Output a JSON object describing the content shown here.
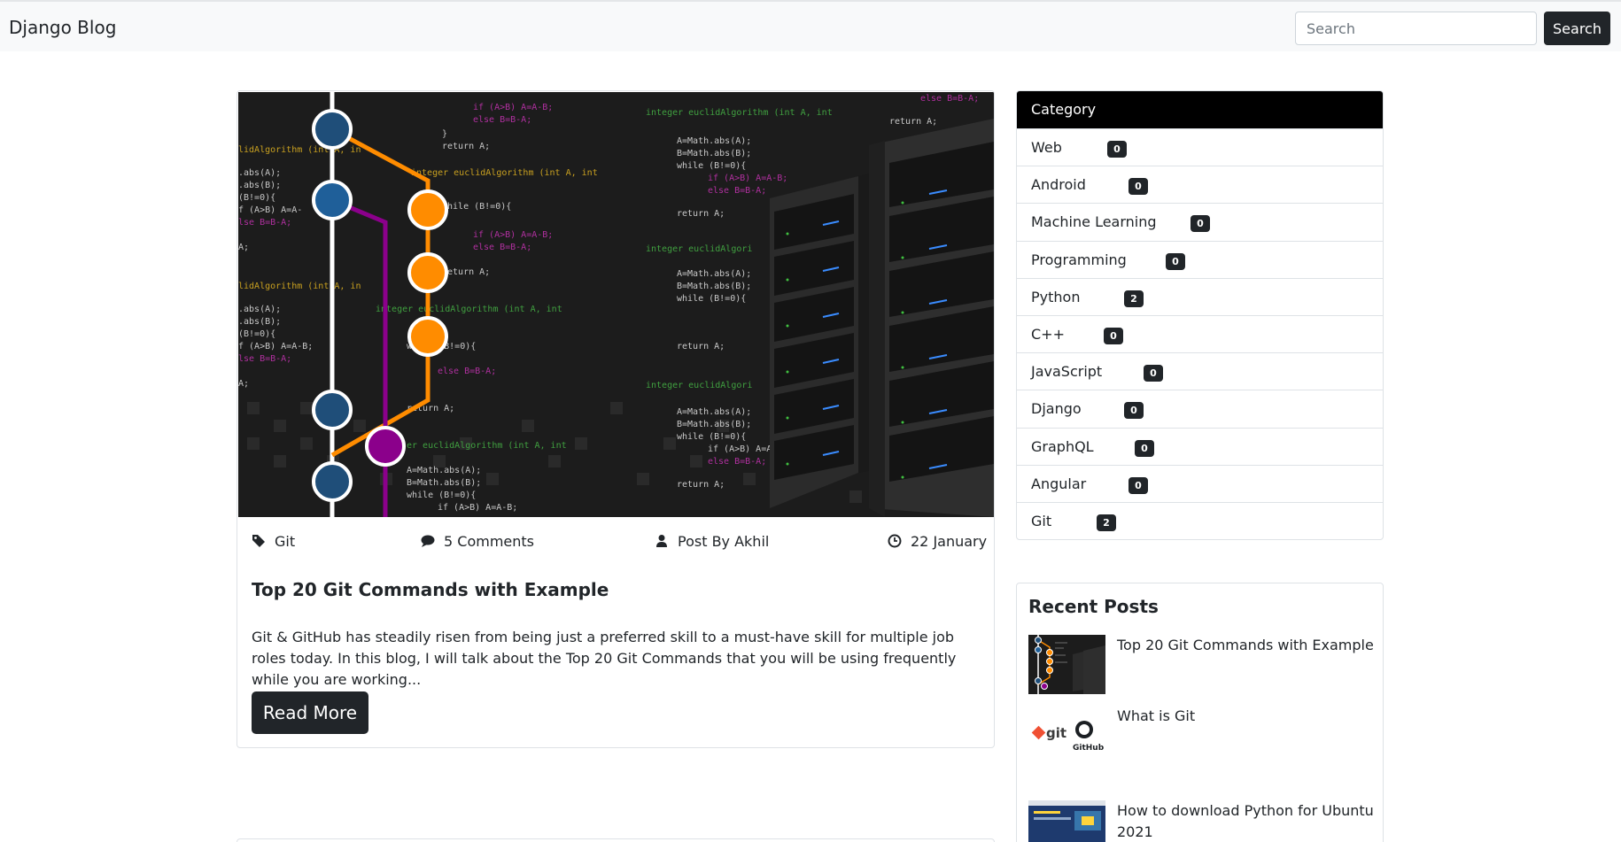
{
  "navbar": {
    "brand": "Django Blog",
    "search_placeholder": "Search",
    "search_button": "Search"
  },
  "post": {
    "category": "Git",
    "comments": "5 Comments",
    "author": "Post By Akhil",
    "date": "22 January",
    "title": "Top 20 Git Commands with Example",
    "excerpt": "Git & GitHub has steadily risen from being just a preferred skill to a must-have skill for multiple job roles today. In this blog, I will talk about the Top 20 Git Commands that you will be using frequently while you are working...",
    "read_more": "Read More"
  },
  "sidebar": {
    "category_title": "Category",
    "categories": [
      {
        "name": "Web",
        "count": "0"
      },
      {
        "name": "Android",
        "count": "0"
      },
      {
        "name": "Machine Learning",
        "count": "0"
      },
      {
        "name": "Programming",
        "count": "0"
      },
      {
        "name": "Python",
        "count": "2"
      },
      {
        "name": "C++",
        "count": "0"
      },
      {
        "name": "JavaScript",
        "count": "0"
      },
      {
        "name": "Django",
        "count": "0"
      },
      {
        "name": "GraphQL",
        "count": "0"
      },
      {
        "name": "Angular",
        "count": "0"
      },
      {
        "name": "Git",
        "count": "2"
      }
    ],
    "recent_title": "Recent Posts",
    "recent_posts": [
      {
        "title": "Top 20 Git Commands with Example"
      },
      {
        "title": "What is Git",
        "logo_text": "git",
        "logo_text2": "GitHub"
      },
      {
        "title": "How to download Python for Ubuntu 2021"
      }
    ]
  },
  "hero_code": {
    "fn": "integer euclidAlgorithm (int A, int B){",
    "l1": "A=Math.abs(A);",
    "l2": "B=Math.abs(B);",
    "l3": "while (B!=0){",
    "l4": "if (A>B) A=A-B;",
    "l5": "else B=B-A;",
    "l6": "return A;"
  },
  "colors": {
    "dark": "#212529",
    "navbar_bg": "#f8f9fa",
    "border": "#dee2e6",
    "git_orange": "#ff8c00",
    "git_purple": "#8b008b",
    "git_blue": "#1f5f99"
  }
}
